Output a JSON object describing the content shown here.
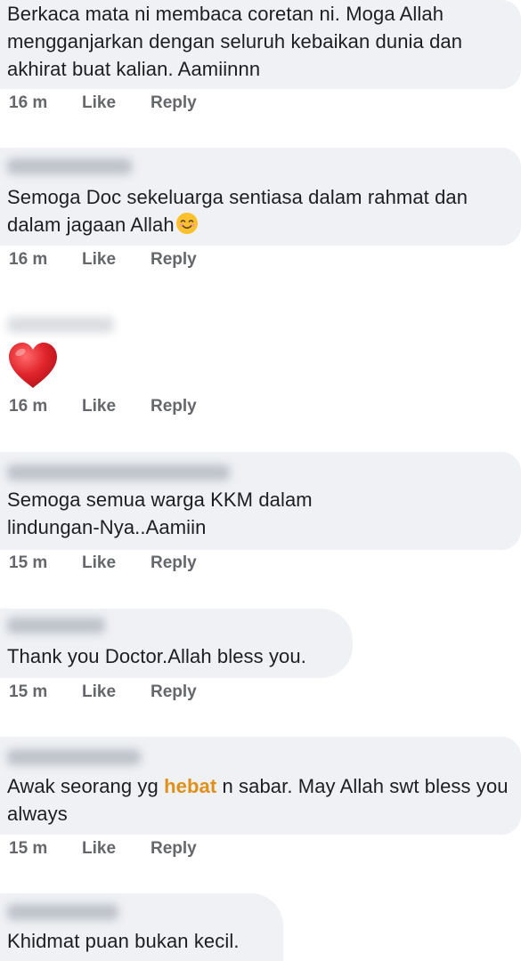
{
  "comments": [
    {
      "text": "Berkaca mata ni membaca coretan ni. Moga Allah mengganjarkan dengan seluruh kebaikan dunia dan akhirat buat kalian. Aamiinnn",
      "time": "16 m",
      "like": "Like",
      "reply": "Reply"
    },
    {
      "text": "Semoga Doc sekeluarga sentiasa dalam rahmat dan dalam jagaan Allah",
      "emoji": "smiling-face-icon",
      "time": "16 m",
      "like": "Like",
      "reply": "Reply"
    },
    {
      "sticker": "red-heart-icon",
      "time": "16 m",
      "like": "Like",
      "reply": "Reply"
    },
    {
      "text": "Semoga semua warga KKM dalam lindungan-Nya..Aamiin",
      "time": "15 m",
      "like": "Like",
      "reply": "Reply"
    },
    {
      "text": "Thank you Doctor.Allah bless you.",
      "time": "15 m",
      "like": "Like",
      "reply": "Reply"
    },
    {
      "text_before": "Awak seorang yg ",
      "text_highlight": "hebat",
      "text_after": " n sabar. May Allah swt bless you always",
      "time": "15 m",
      "like": "Like",
      "reply": "Reply"
    },
    {
      "text": "Khidmat puan bukan kecil."
    }
  ],
  "colors": {
    "bubble": "#eff1f4",
    "text": "#1c1e21",
    "meta": "#65676b",
    "highlight": "#e0901a",
    "heart": "#e0242b"
  }
}
